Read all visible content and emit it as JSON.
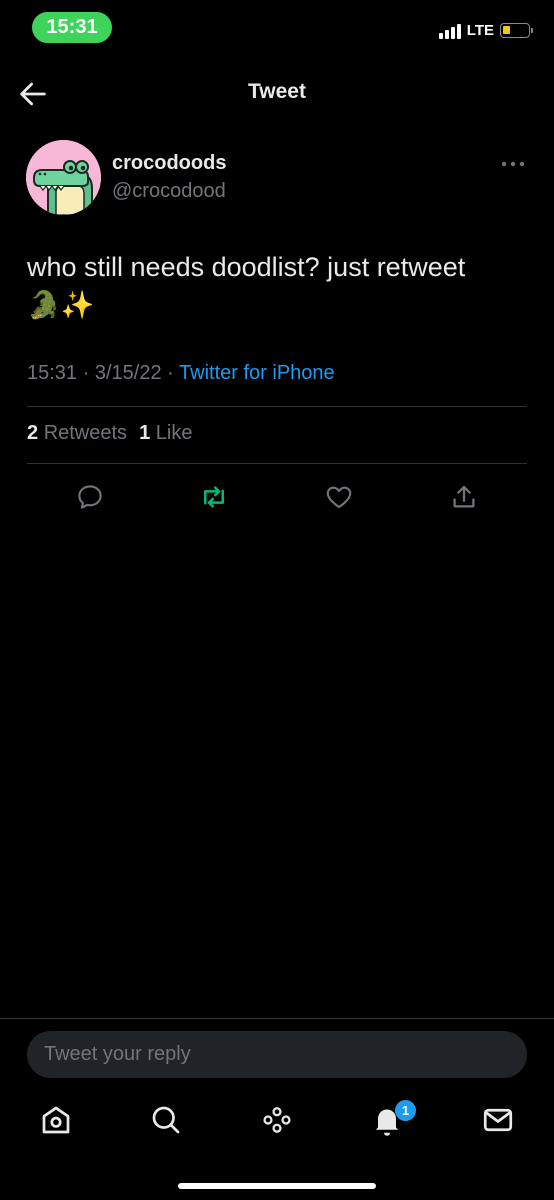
{
  "status_bar": {
    "time": "15:31",
    "network": "LTE",
    "signal_bars": 4,
    "battery_level": 0.2,
    "time_pill_color": "#3ed35a",
    "battery_color": "#f5c518"
  },
  "header": {
    "back_icon": "arrow-left-icon",
    "title": "Tweet"
  },
  "tweet": {
    "author_name": "crocodoods",
    "author_handle": "@crocodood",
    "avatar_icon": "crocodile-avatar",
    "text": "who still needs doodlist? just retweet",
    "emoji": "🐊✨",
    "time": "15:31",
    "date": "3/15/22",
    "source": "Twitter for iPhone",
    "separator": "·",
    "retweets_count": "2",
    "retweets_label": "Retweets",
    "likes_count": "1",
    "likes_label": "Like",
    "more_icon": "more-dots-icon",
    "actions": {
      "reply_icon": "reply-icon",
      "retweet_icon": "retweet-icon",
      "like_icon": "heart-icon",
      "share_icon": "share-icon"
    },
    "retweeted_color": "#00ba7c"
  },
  "reply": {
    "placeholder": "Tweet your reply"
  },
  "tabbar": {
    "items": [
      {
        "icon": "home-icon"
      },
      {
        "icon": "search-icon"
      },
      {
        "icon": "spaces-icon"
      },
      {
        "icon": "notifications-bell-icon"
      },
      {
        "icon": "messages-envelope-icon"
      }
    ],
    "notification_badge": "1",
    "accent_color": "#1d9bf0"
  }
}
